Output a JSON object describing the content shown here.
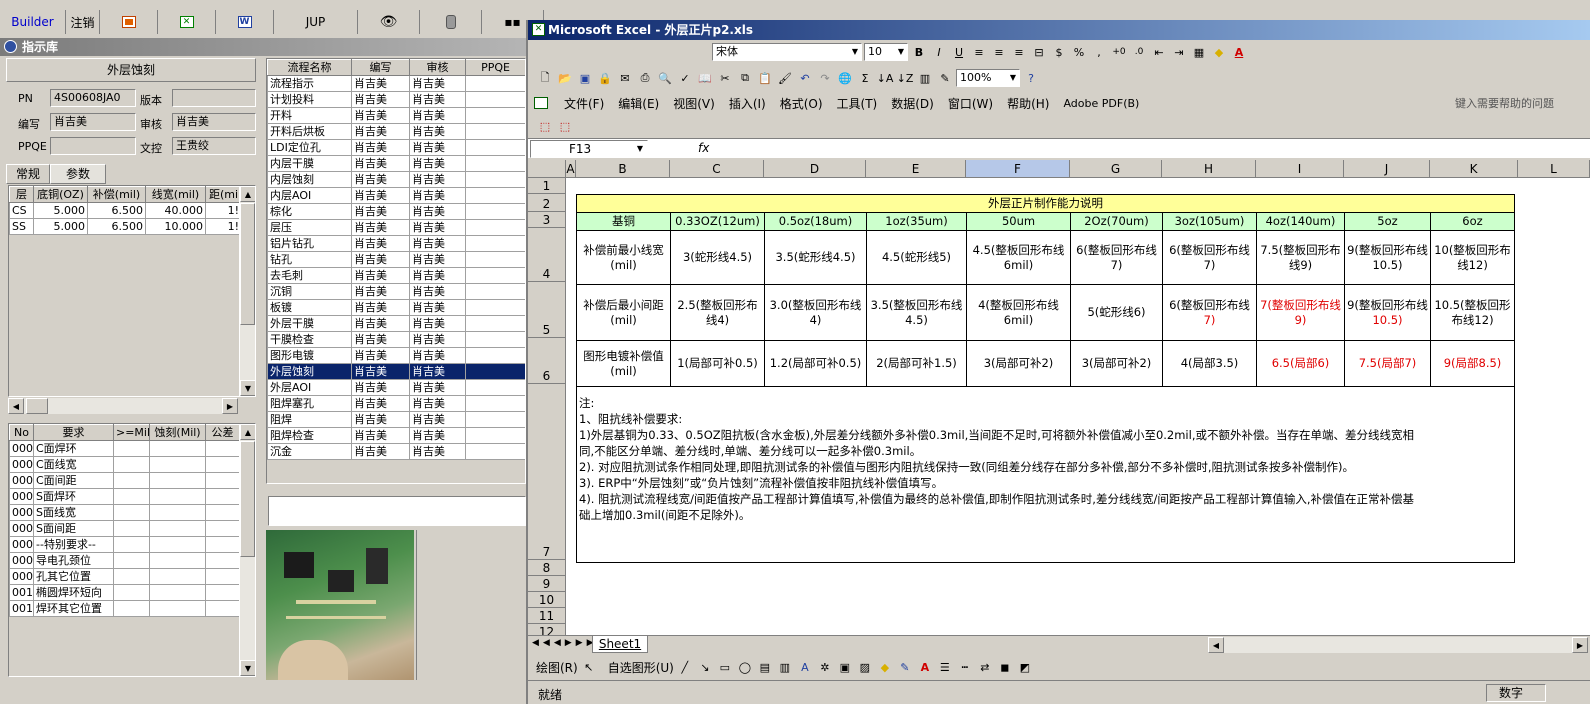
{
  "app": {
    "toolbar": [
      {
        "label": "Builder",
        "icon": ""
      },
      {
        "label": "注销",
        "icon": ""
      },
      {
        "label": "",
        "icon": "powerpoint-icon"
      },
      {
        "label": "",
        "icon": "excel-icon"
      },
      {
        "label": "",
        "icon": "word-icon"
      },
      {
        "label": "JUP",
        "icon": ""
      },
      {
        "label": "",
        "icon": "eye-icon"
      },
      {
        "label": "",
        "icon": "database-icon"
      },
      {
        "label": "",
        "icon": "network-icon"
      }
    ],
    "panel_title": "指示库",
    "process_name": "外层蚀刻",
    "fields": {
      "pn_label": "PN",
      "pn_value": "4S00608JA0",
      "version_label": "版本",
      "version_value": "",
      "author_label": "编写",
      "author_value": "肖吉美",
      "review_label": "审核",
      "review_value": "肖吉美",
      "ppqe_label": "PPQE",
      "ppqe_value": "",
      "control_label": "文控",
      "control_value": "王贵绞"
    },
    "tabs": [
      "常规",
      "参数"
    ],
    "param_table": {
      "headers": [
        "层",
        "底铜(OZ)",
        "补偿(mil)",
        "线宽(mil)",
        "距(mi"
      ],
      "rows": [
        [
          "CS",
          "5.000",
          "6.500",
          "40.000",
          "1!"
        ],
        [
          "SS",
          "5.000",
          "6.500",
          "10.000",
          "1!"
        ]
      ]
    },
    "req_table": {
      "headers": [
        "No",
        "要求",
        ">=Mil",
        "蚀刻(Mil)",
        "公差"
      ],
      "rows": [
        [
          "000",
          "C面焊环"
        ],
        [
          "000",
          "C面线宽"
        ],
        [
          "000",
          "C面间距"
        ],
        [
          "000",
          "S面焊环"
        ],
        [
          "000",
          "S面线宽"
        ],
        [
          "000",
          "S面间距"
        ],
        [
          "000",
          "--特别要求--"
        ],
        [
          "000",
          "导电孔颈位"
        ],
        [
          "000",
          "孔其它位置"
        ],
        [
          "001",
          "椭圆焊环短向"
        ],
        [
          "001",
          "焊环其它位置"
        ]
      ]
    },
    "flow_table": {
      "headers": [
        "流程名称",
        "编写",
        "审核",
        "PPQE"
      ],
      "rows": [
        [
          "流程指示",
          "肖吉美",
          "肖吉美"
        ],
        [
          "计划投料",
          "肖吉美",
          "肖吉美"
        ],
        [
          "开料",
          "肖吉美",
          "肖吉美"
        ],
        [
          "开料后烘板",
          "肖吉美",
          "肖吉美"
        ],
        [
          "LDI定位孔",
          "肖吉美",
          "肖吉美"
        ],
        [
          "内层干膜",
          "肖吉美",
          "肖吉美"
        ],
        [
          "内层蚀刻",
          "肖吉美",
          "肖吉美"
        ],
        [
          "内层AOI",
          "肖吉美",
          "肖吉美"
        ],
        [
          "棕化",
          "肖吉美",
          "肖吉美"
        ],
        [
          "层压",
          "肖吉美",
          "肖吉美"
        ],
        [
          "铝片钻孔",
          "肖吉美",
          "肖吉美"
        ],
        [
          "钻孔",
          "肖吉美",
          "肖吉美"
        ],
        [
          "去毛刺",
          "肖吉美",
          "肖吉美"
        ],
        [
          "沉铜",
          "肖吉美",
          "肖吉美"
        ],
        [
          "板镀",
          "肖吉美",
          "肖吉美"
        ],
        [
          "外层干膜",
          "肖吉美",
          "肖吉美"
        ],
        [
          "干膜检查",
          "肖吉美",
          "肖吉美"
        ],
        [
          "图形电镀",
          "肖吉美",
          "肖吉美"
        ],
        [
          "外层蚀刻",
          "肖吉美",
          "肖吉美"
        ],
        [
          "外层AOI",
          "肖吉美",
          "肖吉美"
        ],
        [
          "阻焊塞孔",
          "肖吉美",
          "肖吉美"
        ],
        [
          "阻焊",
          "肖吉美",
          "肖吉美"
        ],
        [
          "阻焊检查",
          "肖吉美",
          "肖吉美"
        ],
        [
          "沉金",
          "肖吉美",
          "肖吉美"
        ]
      ],
      "selected_index": 18
    }
  },
  "excel": {
    "title": "Microsoft Excel - 外层正片p2.xls",
    "font_name": "宋体",
    "font_size": "10",
    "zoom": "100%",
    "menus": [
      "文件(F)",
      "编辑(E)",
      "视图(V)",
      "插入(I)",
      "格式(O)",
      "工具(T)",
      "数据(D)",
      "窗口(W)",
      "帮助(H)",
      "Adobe PDF(B)"
    ],
    "help_placeholder": "键入需要帮助的问题",
    "name_box": "F13",
    "fx_label": "fx",
    "columns": [
      "A",
      "B",
      "C",
      "D",
      "E",
      "F",
      "G",
      "H",
      "I",
      "J",
      "K",
      "L"
    ],
    "rows": [
      "1",
      "2",
      "3",
      "4",
      "5",
      "6",
      "7",
      "8",
      "9",
      "10",
      "11",
      "12"
    ],
    "sheet_tab": "Sheet1",
    "drawing_label": "绘图(R)",
    "autoshape_label": "自选图形(U)",
    "status_left": "就绪",
    "status_right": "数字",
    "table": {
      "title": "外层正片制作能力说明",
      "header": [
        "基铜",
        "0.33OZ(12um)",
        "0.5oz(18um)",
        "1oz(35um)",
        "50um",
        "2Oz(70um)",
        "3oz(105um)",
        "4oz(140um)",
        "5oz",
        "6oz"
      ],
      "row1_label": "补偿前最小线宽(mil)",
      "row1": [
        "3(蛇形线4.5)",
        "3.5(蛇形线4.5)",
        "4.5(蛇形线5)",
        "4.5(整板回形布线6mil)",
        "6(整板回形布线7)",
        "6(整板回形布线7)",
        "7.5(整板回形布线9)",
        "9(整板回形布线10.5)",
        "10(整板回形布线12)"
      ],
      "row2_label": "补偿后最小间距(mil)",
      "row2": [
        "2.5(整板回形布线4)",
        "3.0(整板回形布线4)",
        "3.5(整板回形布线4.5)",
        "4(整板回形布线6mil)",
        "5(蛇形线6)",
        "6(整板回形布线",
        "7(整板回形布线9)",
        "9(整板回形布线",
        "10.5(整板回形布线12)"
      ],
      "row2_red_parts": [
        "7)",
        "10.5)"
      ],
      "row3_label": "图形电镀补偿值(mil)",
      "row3": [
        "1(局部可补0.5)",
        "1.2(局部可补0.5)",
        "2(局部可补1.5)",
        "3(局部可补2)",
        "3(局部可补2)",
        "4(局部3.5)",
        "6.5(局部6)",
        "7.5(局部7)",
        "9(局部8.5)"
      ],
      "notes": [
        "注:",
        "1、阻抗线补偿要求:",
        "1)外层基铜为0.33、0.5OZ阻抗板(含水金板),外层差分线额外多补偿0.3mil,当间距不足时,可将额外补偿值减小至0.2mil,或不额外补偿。当存在单端、差分线线宽相",
        "同,不能区分单端、差分线时,单端、差分线可以一起多补偿0.3mil。",
        "2). 对应阻抗测试条作相同处理,即阻抗测试条的补偿值与图形内阻抗线保持一致(同组差分线存在部分多补偿,部分不多补偿时,阻抗测试条按多补偿制作)。",
        "3). ERP中“外层蚀刻”或“负片蚀刻”流程补偿值按非阻抗线补偿值填写。",
        "4). 阻抗测试流程线宽/间距值按产品工程部计算值填写,补偿值为最终的总补偿值,即制作阻抗测试条时,差分线线宽/间距按产品工程部计算值输入,补偿值在正常补偿基",
        "础上增加0.3mil(间距不足除外)。"
      ]
    }
  },
  "colors": {
    "title_blue": "#0a246a",
    "selection": "#0a246a",
    "header_yellow": "#ffff99",
    "header_green": "#ccffcc",
    "red_text": "#e00000"
  }
}
